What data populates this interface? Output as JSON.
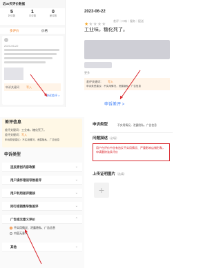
{
  "panel1": {
    "header": "近30天评价数据",
    "stats": [
      {
        "value": "5",
        "label": "好评数"
      },
      {
        "value": "1",
        "label": "中评数"
      },
      {
        "value": "0",
        "label": "差评数"
      }
    ],
    "tabs": [
      "多评价",
      "价格"
    ],
    "date": "2023-06-22",
    "complaint_label": "申诉关键词",
    "complaint_value": "写入",
    "link": "申诉差评 >"
  },
  "panel2": {
    "date": "2023-06-22",
    "stars": 1,
    "star_max": 5,
    "tags": [
      "差评",
      "口味",
      "服务",
      "配送"
    ],
    "headline": "工业味，糖化死了。",
    "more": "更多",
    "complaint_label": "差评关键词：",
    "complaint_value": "写入",
    "type_text": "申诉类型建议：不实用情况，泄露隐私，广告信息",
    "appeal_link": "申诉差评 >"
  },
  "panel3": {
    "title": "差评信息",
    "line1": "差评关键词：工业味，糖化死了。",
    "line2_label": "差评关键词：",
    "line2_value": "写入",
    "line3": "申诉类型建议：不实用情况，泄露隐私，广告信息",
    "section_title": "申诉类型",
    "rows": [
      "违反原创内容政策",
      "用户操作错误导致差评",
      "用户利用差评要挟",
      "同行或销售导致差评",
      "广告或无意义评价"
    ],
    "options": [
      {
        "label": "不实用情况、泄露隐私、广告信息",
        "selected": true
      },
      {
        "label": "内容无意义",
        "selected": false
      }
    ],
    "other": "其他"
  },
  "panel4": {
    "type_label": "申诉类型",
    "type_value": "不实用情况，泄露隐私，广告信息",
    "desc_label": "问题描述",
    "desc_hint": "（必填）",
    "desc_text": "用户在评价中含有违反不实用情况、严重影响店铺形象，申请删除该条评价",
    "upload_label": "上传证明图片",
    "upload_hint": "（选填）",
    "plus": "+"
  },
  "colors": {
    "accent": "#f07c1e",
    "red": "#d9262c",
    "star": "#f5a623"
  }
}
